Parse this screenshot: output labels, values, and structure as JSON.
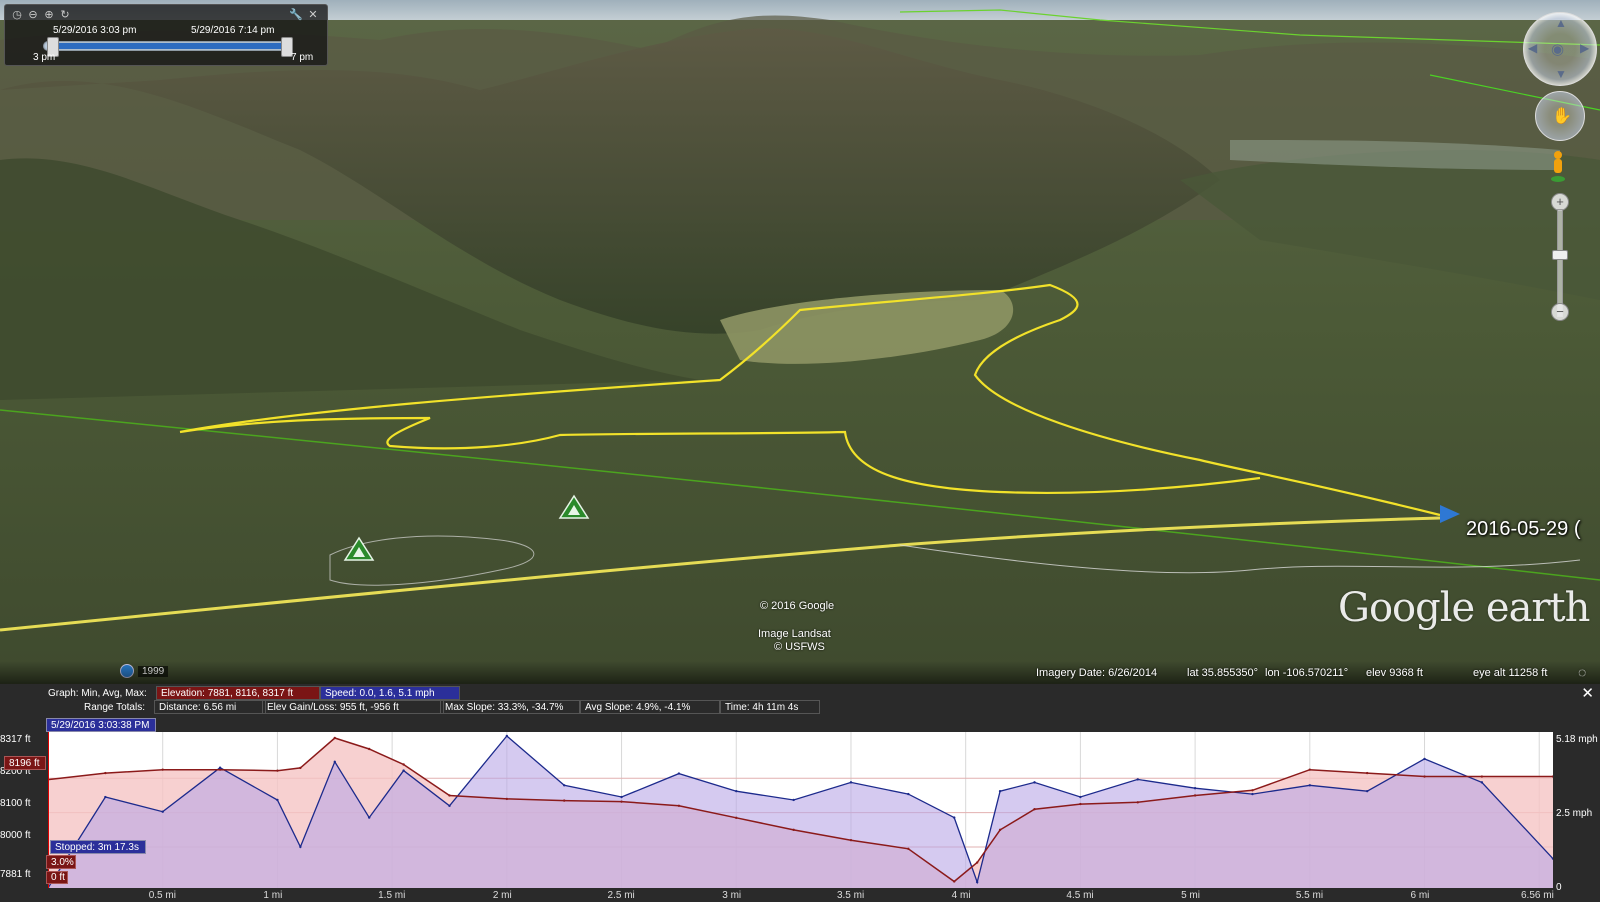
{
  "time_slider": {
    "start_datetime": "5/29/2016   3:03 pm",
    "end_datetime": "5/29/2016   7:14 pm",
    "start_hour": "3 pm",
    "end_hour": "7 pm"
  },
  "map": {
    "track_label": "2016-05-29 (",
    "logo": "Google earth",
    "copyright": "© 2016 Google",
    "image_source": "Image Landsat",
    "image_source2": "© USFWS",
    "history_year": "1999"
  },
  "status": {
    "imagery_date": "Imagery Date: 6/26/2014",
    "lat": "lat   35.855350°",
    "lon": "lon -106.570211°",
    "elev": "elev  9368 ft",
    "eye_alt": "eye alt  11258 ft"
  },
  "profile": {
    "graph_label": "Graph:  Min, Avg, Max:",
    "elevation": "Elevation:  7881, 8116, 8317 ft",
    "speed": "Speed:  0.0, 1.6, 5.1 mph",
    "range_totals": "Range Totals:",
    "distance": "Distance: 6.56 mi",
    "elev_gain": "Elev Gain/Loss: 955 ft, -956 ft",
    "max_slope": "Max Slope: 33.3%, -34.7%",
    "avg_slope": "Avg Slope: 4.9%, -4.1%",
    "time": "Time:  4h 11m 4s",
    "timestamp": "5/29/2016 3:03:38 PM",
    "cursor_elev": "8196 ft",
    "stopped": "Stopped:  3m 17.3s",
    "cursor_slope": "3.0%",
    "cursor_dist": "0 ft",
    "y_left": [
      "8317 ft",
      "8200 ft",
      "8100 ft",
      "8000 ft",
      "7881 ft"
    ],
    "y_right": [
      "5.18 mph",
      "2.5 mph",
      "0"
    ],
    "x_ticks": [
      "0.5 mi",
      "1 mi",
      "1.5 mi",
      "2 mi",
      "2.5 mi",
      "3 mi",
      "3.5 mi",
      "4 mi",
      "4.5 mi",
      "5 mi",
      "5.5 mi",
      "6 mi",
      "6.56 mi"
    ]
  },
  "chart_data": {
    "type": "line",
    "x": [
      0,
      0.25,
      0.5,
      0.75,
      1.0,
      1.1,
      1.25,
      1.4,
      1.55,
      1.75,
      2.0,
      2.25,
      2.5,
      2.75,
      3.0,
      3.25,
      3.5,
      3.75,
      3.95,
      4.05,
      4.15,
      4.3,
      4.5,
      4.75,
      5.0,
      5.25,
      5.5,
      5.75,
      6.0,
      6.25,
      6.56
    ],
    "series": [
      {
        "name": "Elevation",
        "color": "#8b1a1a",
        "values": [
          8196,
          8215,
          8225,
          8225,
          8222,
          8230,
          8317,
          8285,
          8240,
          8150,
          8140,
          8135,
          8132,
          8120,
          8085,
          8050,
          8020,
          7995,
          7900,
          7955,
          8050,
          8110,
          8125,
          8130,
          8150,
          8165,
          8225,
          8215,
          8205,
          8205,
          8205
        ]
      },
      {
        "name": "Speed",
        "color": "#1c2a8c",
        "values": [
          0.0,
          3.1,
          2.6,
          4.1,
          3.0,
          1.4,
          4.3,
          2.4,
          4.0,
          2.8,
          5.18,
          3.5,
          3.1,
          3.9,
          3.3,
          3.0,
          3.6,
          3.2,
          2.4,
          0.2,
          3.3,
          3.6,
          3.1,
          3.7,
          3.4,
          3.2,
          3.5,
          3.3,
          4.4,
          3.6,
          1.0
        ]
      }
    ],
    "xlim": [
      0,
      6.56
    ],
    "ylim_elevation": [
      7881,
      8317
    ],
    "ylim_speed": [
      0,
      5.18
    ],
    "xlabel": "",
    "ylabel": "",
    "grid": true
  }
}
